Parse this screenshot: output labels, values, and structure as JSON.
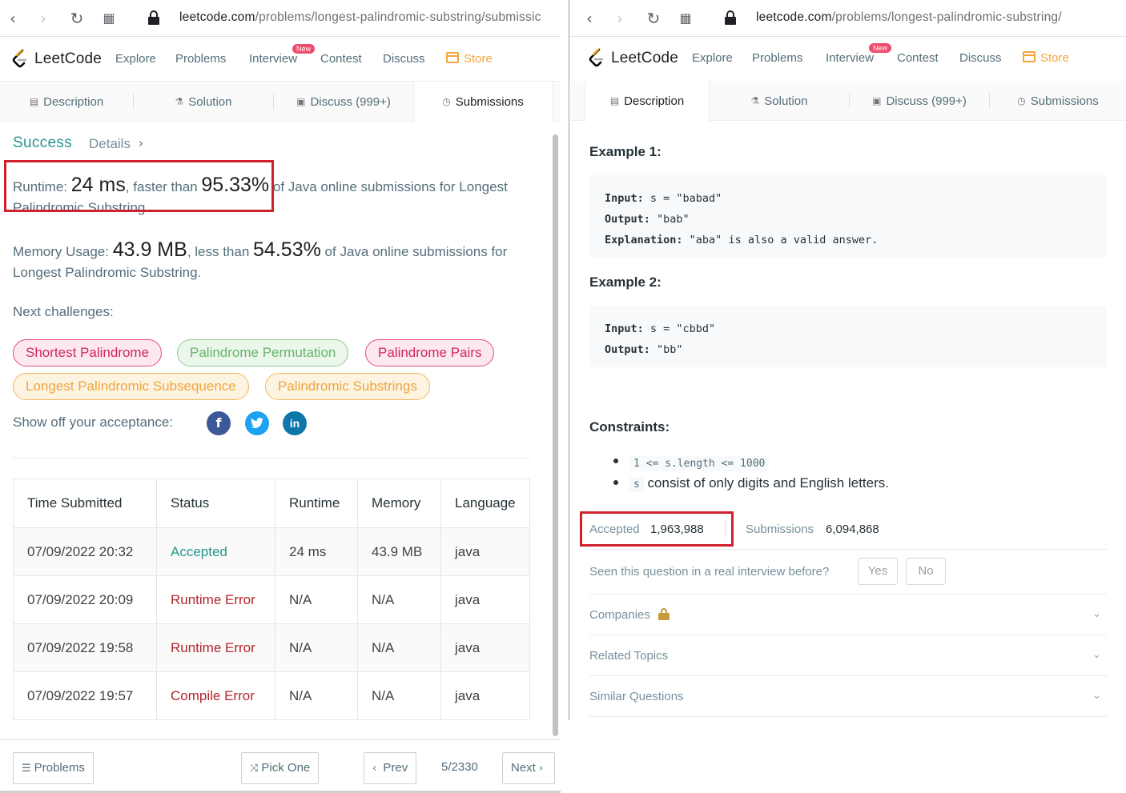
{
  "left": {
    "browser": {
      "url_domain": "leetcode.com",
      "url_path": "/problems/longest-palindromic-substring/submissic"
    },
    "header": {
      "logo_text": "LeetCode",
      "nav": [
        "Explore",
        "Problems",
        "Interview",
        "Contest",
        "Discuss"
      ],
      "store": "Store",
      "new_badge": "New"
    },
    "tabs": [
      "Description",
      "Solution",
      "Discuss (999+)",
      "Submissions"
    ],
    "result": {
      "status": "Success",
      "details": "Details",
      "runtime_prefix": "Runtime: ",
      "runtime_value": "24 ms",
      "runtime_mid": ", faster than ",
      "runtime_pct": "95.33%",
      "runtime_suffix": " of Java online submissions for Longest Palindromic Substring.",
      "memory_prefix": "Memory Usage: ",
      "memory_value": "43.9 MB",
      "memory_mid": ", less than ",
      "memory_pct": "54.53%",
      "memory_suffix": " of Java online submissions for Longest Palindromic Substring."
    },
    "next_challenges_label": "Next challenges:",
    "challenges": [
      "Shortest Palindrome",
      "Palindrome Permutation",
      "Palindrome Pairs",
      "Longest Palindromic Subsequence",
      "Palindromic Substrings"
    ],
    "share_label": "Show off your acceptance:",
    "social": [
      "facebook-icon",
      "twitter-icon",
      "linkedin-icon"
    ],
    "table": {
      "headers": [
        "Time Submitted",
        "Status",
        "Runtime",
        "Memory",
        "Language"
      ],
      "rows": [
        [
          "07/09/2022 20:32",
          "Accepted",
          "24 ms",
          "43.9 MB",
          "java"
        ],
        [
          "07/09/2022 20:09",
          "Runtime Error",
          "N/A",
          "N/A",
          "java"
        ],
        [
          "07/09/2022 19:58",
          "Runtime Error",
          "N/A",
          "N/A",
          "java"
        ],
        [
          "07/09/2022 19:57",
          "Compile Error",
          "N/A",
          "N/A",
          "java"
        ]
      ]
    },
    "bottom": {
      "problems": "Problems",
      "pick_one": "Pick One",
      "prev": "Prev",
      "page": "5/2330",
      "next": "Next"
    }
  },
  "right": {
    "browser": {
      "url_domain": "leetcode.com",
      "url_path": "/problems/longest-palindromic-substring/"
    },
    "example1": {
      "title": "Example 1:",
      "input_label": "Input:",
      "input": " s = \"babad\"",
      "output_label": "Output:",
      "output": " \"bab\"",
      "explanation_label": "Explanation:",
      "explanation": " \"aba\" is also a valid answer."
    },
    "example2": {
      "title": "Example 2:",
      "input_label": "Input:",
      "input": " s = \"cbbd\"",
      "output_label": "Output:",
      "output": " \"bb\""
    },
    "constraints_title": "Constraints:",
    "constraint1_code": "1 <= s.length <= 1000",
    "constraint2_code": "s",
    "constraint2_text": " consist of only digits and English letters.",
    "accepted_label": "Accepted",
    "accepted_value": "1,963,988",
    "submissions_label": "Submissions",
    "submissions_value": "6,094,868",
    "interview_question": "Seen this question in a real interview before?",
    "yes": "Yes",
    "no": "No",
    "sections": [
      "Companies",
      "Related Topics",
      "Similar Questions"
    ]
  }
}
